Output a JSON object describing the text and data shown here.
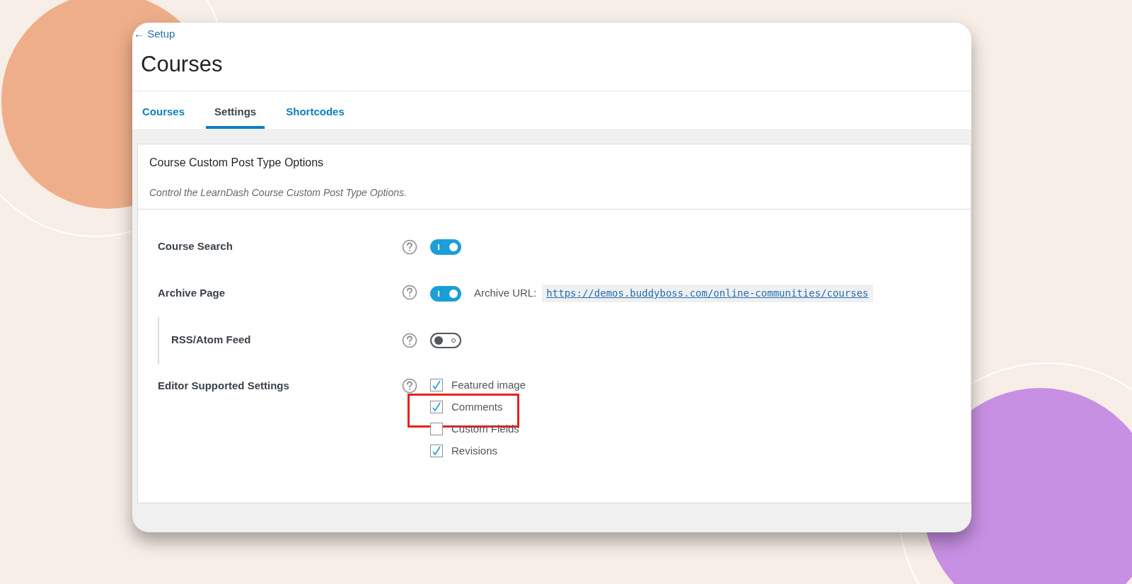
{
  "back_link": "← Setup",
  "title": "Courses",
  "tabs": [
    {
      "label": "Courses",
      "selected": false
    },
    {
      "label": "Settings",
      "selected": true
    },
    {
      "label": "Shortcodes",
      "selected": false
    }
  ],
  "section": {
    "title": "Course Custom Post Type Options",
    "description": "Control the LearnDash Course Custom Post Type Options.",
    "settings": [
      {
        "kind": "toggle",
        "label": "Course Search",
        "on": true
      },
      {
        "kind": "toggle",
        "label": "Archive Page",
        "on": true,
        "url_label": "Archive URL:",
        "url": "https://demos.buddyboss.com/online-communities/courses",
        "children": [
          {
            "kind": "toggle",
            "label": "RSS/Atom Feed",
            "on": false
          }
        ]
      },
      {
        "kind": "checkboxes",
        "label": "Editor Supported Settings",
        "options": [
          {
            "label": "Featured image",
            "checked": true,
            "highlighted": false
          },
          {
            "label": "Comments",
            "checked": true,
            "highlighted": true
          },
          {
            "label": "Custom Fields",
            "checked": false,
            "highlighted": false
          },
          {
            "label": "Revisions",
            "checked": true,
            "highlighted": false
          }
        ]
      }
    ]
  }
}
